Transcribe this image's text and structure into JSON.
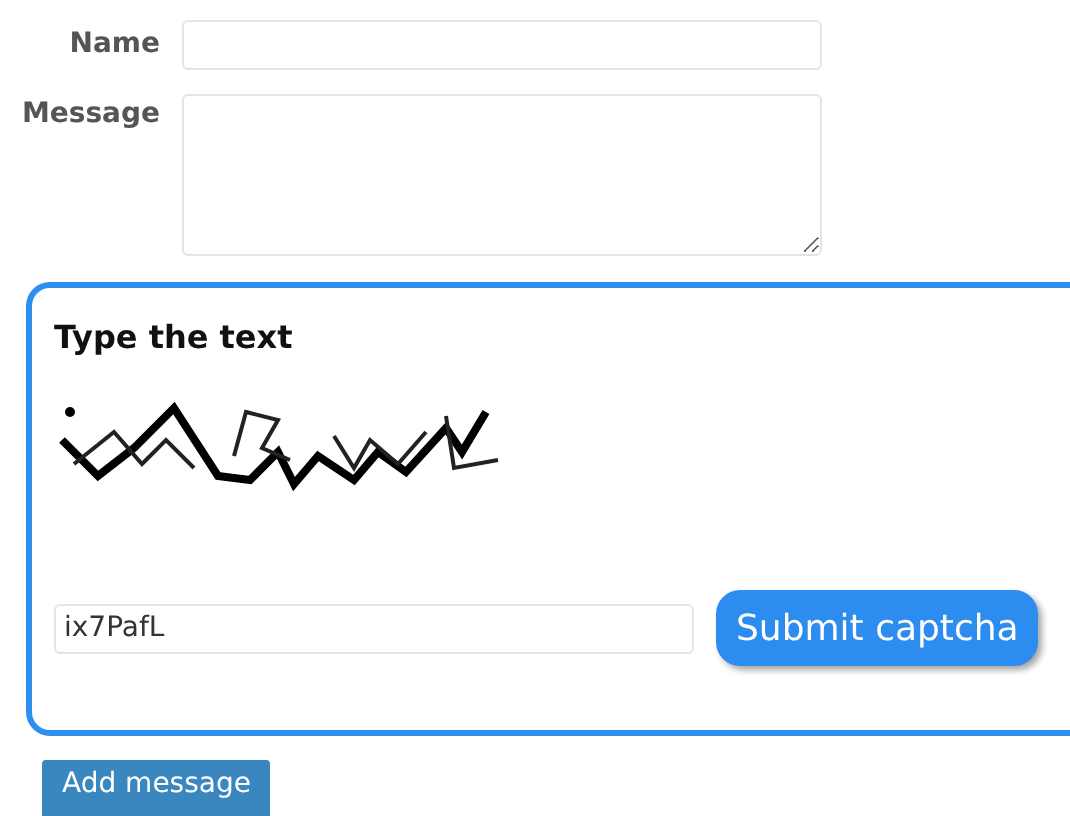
{
  "form": {
    "fields": [
      {
        "kind": "input",
        "label": "Name"
      },
      {
        "kind": "textarea",
        "label": "Message"
      }
    ]
  },
  "captcha": {
    "title": "Type the text",
    "answer": "ix7PafL",
    "submit": "Submit captcha"
  },
  "buttons": [
    "Add message"
  ]
}
